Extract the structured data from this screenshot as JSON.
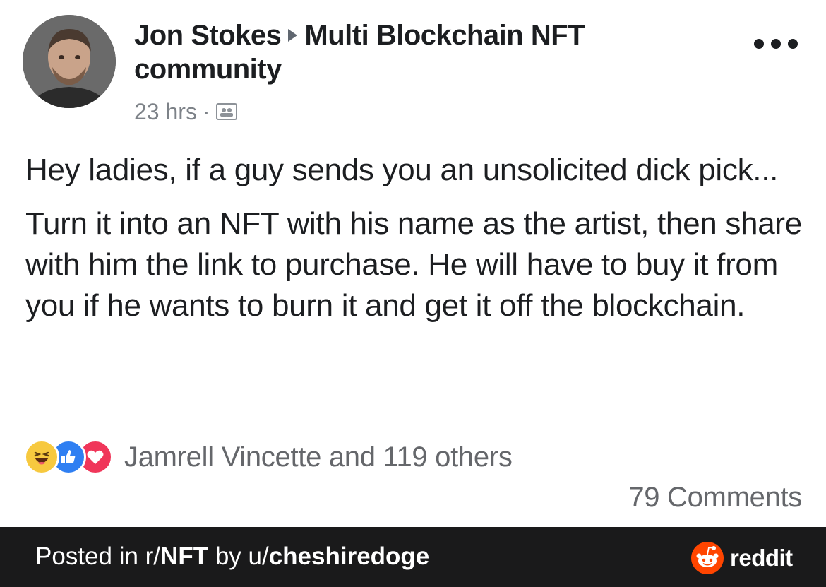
{
  "post": {
    "author": "Jon Stokes",
    "group": "Multi Blockchain NFT",
    "group_line2": "community",
    "time": "23 hrs",
    "time_separator": "·",
    "privacy_icon": "group-icon",
    "more_icon": "more-options-icon",
    "body_paragraph_1": "Hey ladies, if a guy sends you an unsolicited dick pick...",
    "body_paragraph_2": "Turn it into an NFT with his name as the artist, then share with him the link to purchase. He will have to buy it from you if he wants to burn it and get it off the blockchain.",
    "reactions": {
      "icons": [
        "haha-reaction-icon",
        "like-reaction-icon",
        "love-reaction-icon"
      ],
      "text": "Jamrell Vincette and 119 others"
    },
    "comments": "79 Comments"
  },
  "footer": {
    "prefix": "Posted in r/",
    "subreddit": "NFT",
    "by": " by u/",
    "username": "cheshiredoge",
    "brand": "reddit",
    "brand_icon": "reddit-logo-icon"
  },
  "colors": {
    "text": "#1c1e21",
    "secondary": "#65676b",
    "footer_bg": "#1a1a1b",
    "reddit_orange": "#ff4500",
    "like_blue": "#2f7ff2",
    "love_red": "#f0365a",
    "haha_yellow": "#f7c93f"
  }
}
